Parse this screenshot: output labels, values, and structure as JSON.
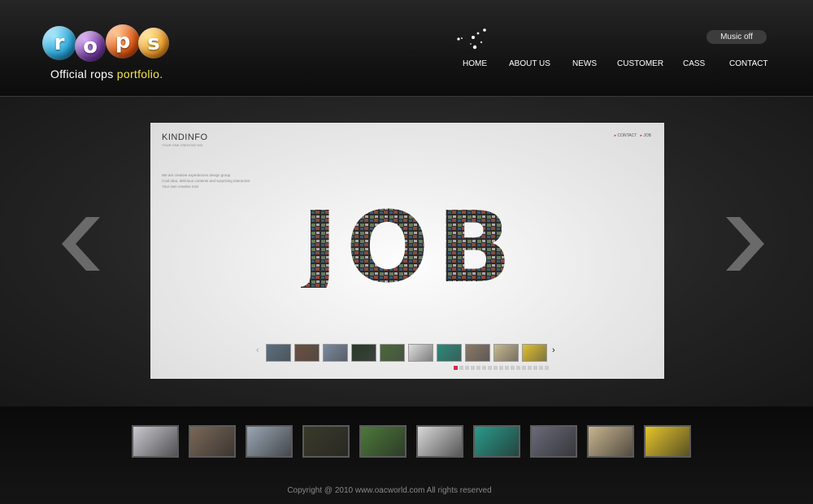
{
  "header": {
    "logo_letters": [
      "r",
      "o",
      "p",
      "s"
    ],
    "logo_colors": [
      "#2aa6d8",
      "#7a3fa6",
      "#e25b16",
      "#f2a12b"
    ],
    "tagline_main": "Official rops",
    "tagline_highlight": "portfolio.",
    "music_button": "Music off",
    "nav": [
      "HOME",
      "ABOUT US",
      "NEWS",
      "CUSTOMER",
      "CASS",
      "CONTACT"
    ]
  },
  "slide": {
    "brand": "KINDINFO",
    "brand_sub": "YOUR ONE CREATIVE MIX",
    "links": [
      "CONTACT",
      "JOB"
    ],
    "description": [
      "We are creative experiences design group",
      "Cool idea, delicious contents and surprising interactive",
      "Your own creative mix!"
    ],
    "headline": "JOB",
    "mini_thumb_colors": [
      "#5a7080",
      "#6b5040",
      "#7a8aa0",
      "#2a3a2a",
      "#4a6a3a",
      "#ddd",
      "#2a8a7a",
      "#8a7a6a",
      "#c8b890",
      "#e0c030"
    ],
    "dot_count": 17,
    "active_dot": 0
  },
  "thumbnails": [
    {
      "name": "people-group",
      "color": "#c8c8d0"
    },
    {
      "name": "office-team",
      "color": "#7a6858"
    },
    {
      "name": "city-map",
      "color": "#9aa6b4"
    },
    {
      "name": "dark-group",
      "color": "#3a3a2a"
    },
    {
      "name": "green-field",
      "color": "#4c7a3a"
    },
    {
      "name": "black-white",
      "color": "#d8d8d8"
    },
    {
      "name": "teal-figure",
      "color": "#2a9a8a"
    },
    {
      "name": "city-skyline",
      "color": "#6a6a7a"
    },
    {
      "name": "beige-site",
      "color": "#c8b48e"
    },
    {
      "name": "yellow-people",
      "color": "#e4c42a"
    }
  ],
  "footer": {
    "copyright": "Copyright @ 2010 www.oacworld.com All rights reserved"
  },
  "colors": {
    "accent": "#f4e44a",
    "background": "#111111"
  }
}
